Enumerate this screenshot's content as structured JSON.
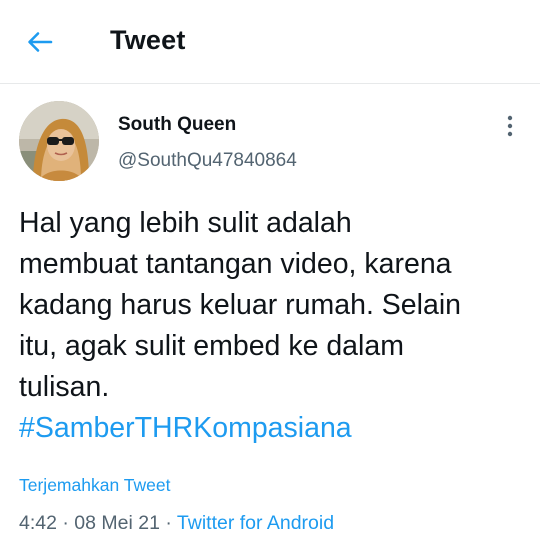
{
  "header": {
    "back_icon": "arrow-left-icon",
    "title": "Tweet"
  },
  "colors": {
    "accent": "#1d9bf0",
    "text": "#0f1419",
    "secondary_text": "#536471",
    "divider": "#e7e9ea"
  },
  "author": {
    "display_name": "South Queen",
    "handle": "@SouthQu47840864",
    "more_icon": "more-vertical-icon"
  },
  "tweet": {
    "lines": [
      "Hal yang lebih sulit adalah",
      "membuat tantangan video, karena",
      "kadang harus keluar rumah. Selain",
      "itu, agak sulit embed ke dalam",
      "tulisan."
    ],
    "hashtag": "#SamberTHRKompasiana"
  },
  "translate_label": "Terjemahkan Tweet",
  "meta": {
    "time": "4:42",
    "separator": " · ",
    "date": "08 Mei 21",
    "source": "Twitter for Android"
  }
}
